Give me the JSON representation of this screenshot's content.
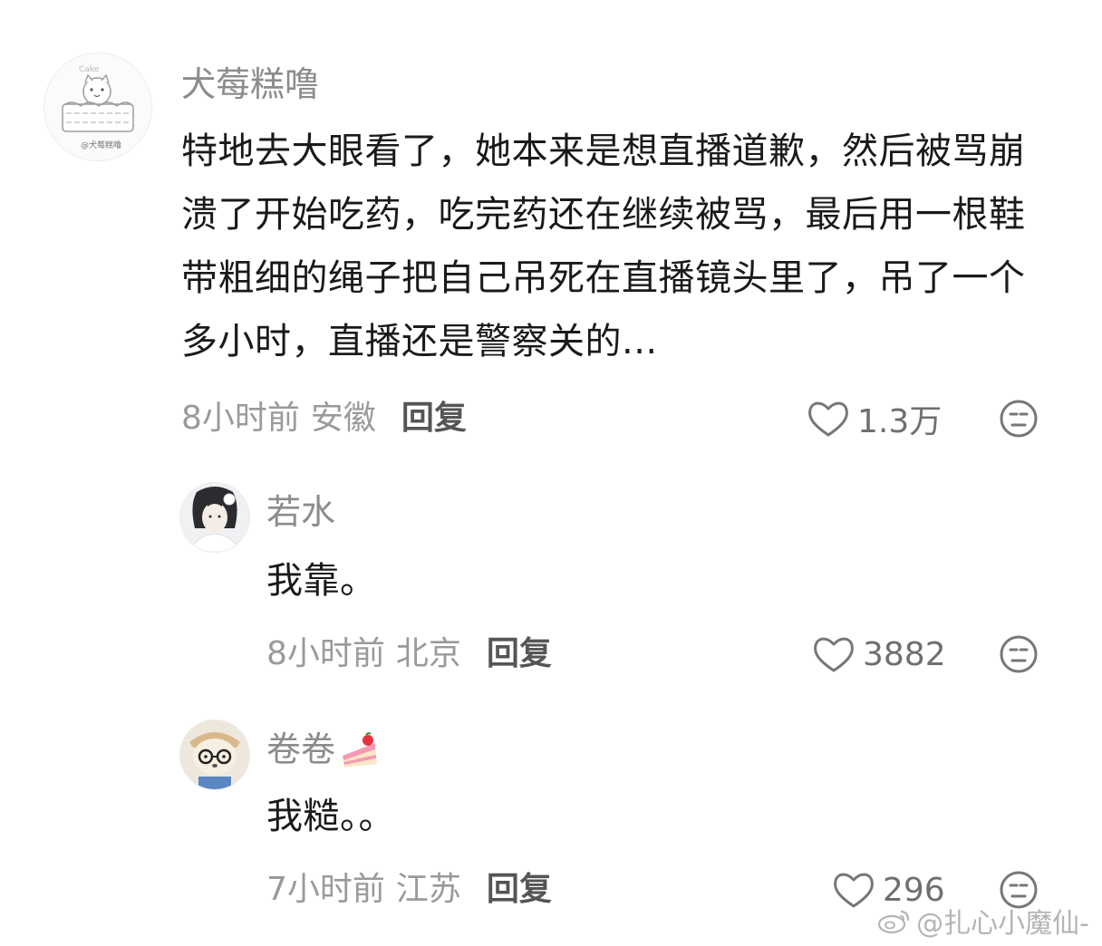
{
  "comments": [
    {
      "username": "犬莓糕噜",
      "text": "特地去大眼看了，她本来是想直播道歉，然后被骂崩溃了开始吃药，吃完药还在继续被骂，最后用一根鞋带粗细的绳子把自己吊死在直播镜头里了，吊了一个多小时，直播还是警察关的...",
      "time": "8小时前",
      "location": "安徽",
      "reply": "回复",
      "likes": "1.3万",
      "avatar_caption": "@犬莓糕噜",
      "avatar_logo": "Cake"
    },
    {
      "username": "若水",
      "text": "我靠。",
      "time": "8小时前",
      "location": "北京",
      "reply": "回复",
      "likes": "3882"
    },
    {
      "username": "卷卷",
      "text": "我糙。。",
      "time": "7小时前",
      "location": "江苏",
      "reply": "回复",
      "likes": "296"
    }
  ],
  "watermark": "@扎心小魔仙-",
  "icons": {
    "like": "heart-outline-icon",
    "reaction": "neutral-face-icon",
    "badge": "cake-emoji-icon",
    "watermark": "weibo-logo-icon"
  },
  "colors": {
    "username": "#8c8c8c",
    "text": "#1a1a1a",
    "meta": "#9a9a9a",
    "reply": "#555555"
  }
}
